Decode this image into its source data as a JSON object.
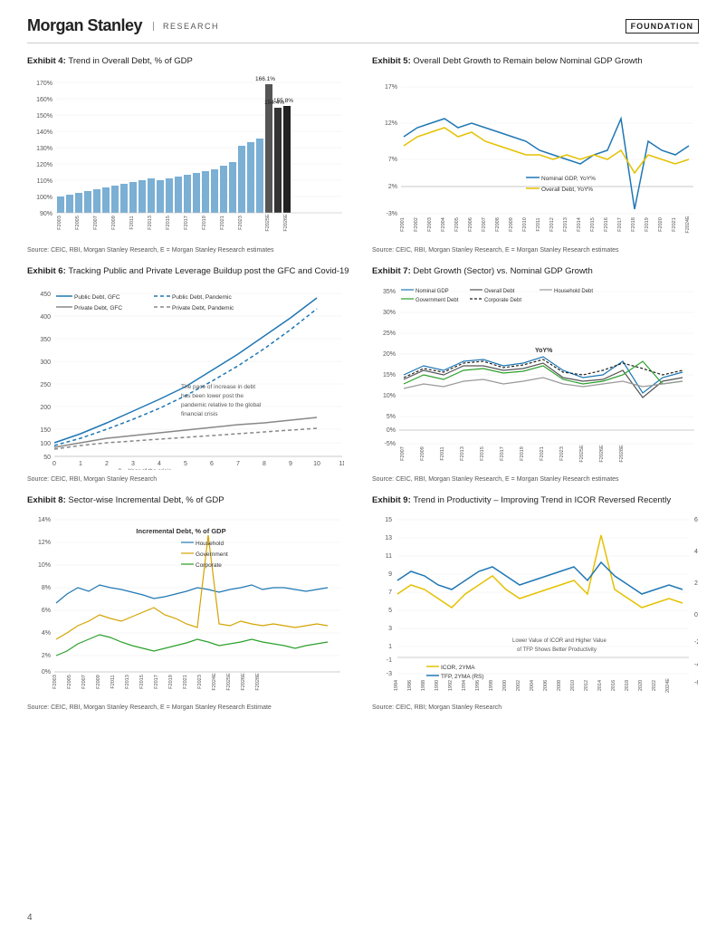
{
  "header": {
    "brand": "Morgan Stanley",
    "research_label": "RESEARCH",
    "foundation_label": "FOUNDATION"
  },
  "exhibits": [
    {
      "id": "exhibit4",
      "num": "Exhibit 4:",
      "title": "Trend in Overall Debt, % of GDP",
      "source": "Source: CEIC, RBI, Morgan Stanley Research, E = Morgan Stanley Research estimates"
    },
    {
      "id": "exhibit5",
      "num": "Exhibit 5:",
      "title": "Overall Debt Growth to Remain below Nominal GDP Growth",
      "source": "Source: CEIC, RBI, Morgan Stanley Research, E = Morgan Stanley Research estimates"
    },
    {
      "id": "exhibit6",
      "num": "Exhibit 6:",
      "title": "Tracking Public and Private Leverage Buildup post the GFC and Covid-19",
      "source": "Source: CEIC, RBI, Morgan Stanley Research"
    },
    {
      "id": "exhibit7",
      "num": "Exhibit 7:",
      "title": "Debt Growth (Sector) vs. Nominal GDP Growth",
      "source": "Source: CEIC, RBI, Morgan Stanley Research, E = Morgan Stanley Research estimates"
    },
    {
      "id": "exhibit8",
      "num": "Exhibit 8:",
      "title": "Sector-wise Incremental Debt, % of GDP",
      "source": "Source: CEIC, RBI, Morgan Stanley Research, E = Morgan Stanley Research Estimate"
    },
    {
      "id": "exhibit9",
      "num": "Exhibit 9:",
      "title": "Trend in Productivity – Improving Trend in ICOR Reversed Recently",
      "source": "Source: CEIC, RBI; Morgan Stanley Research"
    }
  ],
  "page_number": "4"
}
